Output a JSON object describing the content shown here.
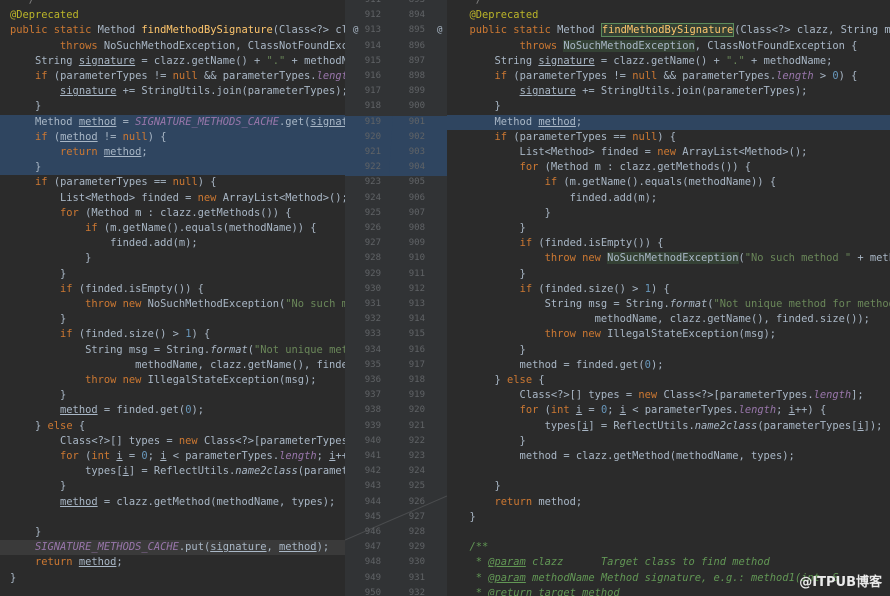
{
  "left_lines": [
    [
      {
        "t": "  */",
        "c": "cmt"
      }
    ],
    [
      {
        "t": "@Deprecated",
        "c": "ann"
      }
    ],
    [
      {
        "t": "public static ",
        "c": "kw"
      },
      {
        "t": "Method "
      },
      {
        "t": "findMethodBySignature",
        "c": "fn"
      },
      {
        "t": "(Class<?> cla"
      }
    ],
    [
      {
        "t": "        "
      },
      {
        "t": "throws ",
        "c": "kw"
      },
      {
        "t": "NoSuchMethodException, ClassNotFoundException"
      }
    ],
    [
      {
        "t": "    String "
      },
      {
        "t": "signature",
        "c": "u"
      },
      {
        "t": " = clazz.getName() + "
      },
      {
        "t": "\".\"",
        "c": "str"
      },
      {
        "t": " + methodName;"
      }
    ],
    [
      {
        "t": "    "
      },
      {
        "t": "if ",
        "c": "kw"
      },
      {
        "t": "(parameterTypes != "
      },
      {
        "t": "null ",
        "c": "kw"
      },
      {
        "t": "&& parameterTypes."
      },
      {
        "t": "length",
        "c": "fld"
      },
      {
        "t": " > "
      },
      {
        "t": "0",
        "c": "num"
      },
      {
        "t": ")"
      }
    ],
    [
      {
        "t": "        "
      },
      {
        "t": "signature",
        "c": "u"
      },
      {
        "t": " += StringUtils.join(parameterTypes);"
      }
    ],
    [
      {
        "t": "    }"
      }
    ],
    [
      {
        "t": "    Method "
      },
      {
        "t": "method",
        "c": "u"
      },
      {
        "t": " = "
      },
      {
        "t": "SIGNATURE_METHODS_CACHE",
        "c": "fld"
      },
      {
        "t": ".get("
      },
      {
        "t": "signature",
        "c": "u"
      },
      {
        "t": ");"
      }
    ],
    [
      {
        "t": "    "
      },
      {
        "t": "if ",
        "c": "kw"
      },
      {
        "t": "("
      },
      {
        "t": "method",
        "c": "u"
      },
      {
        "t": " != "
      },
      {
        "t": "null",
        "c": "kw"
      },
      {
        "t": ") {"
      }
    ],
    [
      {
        "t": "        "
      },
      {
        "t": "return ",
        "c": "kw"
      },
      {
        "t": "method",
        "c": "u"
      },
      {
        "t": ";"
      }
    ],
    [
      {
        "t": "    }"
      }
    ],
    [
      {
        "t": "    "
      },
      {
        "t": "if ",
        "c": "kw"
      },
      {
        "t": "(parameterTypes == "
      },
      {
        "t": "null",
        "c": "kw"
      },
      {
        "t": ") {"
      }
    ],
    [
      {
        "t": "        List<Method> finded = "
      },
      {
        "t": "new ",
        "c": "kw"
      },
      {
        "t": "ArrayList<Method>();"
      }
    ],
    [
      {
        "t": "        "
      },
      {
        "t": "for ",
        "c": "kw"
      },
      {
        "t": "(Method m : clazz.getMethods()) {"
      }
    ],
    [
      {
        "t": "            "
      },
      {
        "t": "if ",
        "c": "kw"
      },
      {
        "t": "(m.getName().equals(methodName)) {"
      }
    ],
    [
      {
        "t": "                finded.add(m);"
      }
    ],
    [
      {
        "t": "            }"
      }
    ],
    [
      {
        "t": "        }"
      }
    ],
    [
      {
        "t": "        "
      },
      {
        "t": "if ",
        "c": "kw"
      },
      {
        "t": "(finded.isEmpty()) {"
      }
    ],
    [
      {
        "t": "            "
      },
      {
        "t": "throw new ",
        "c": "kw"
      },
      {
        "t": "NoSuchMethodException("
      },
      {
        "t": "\"No such method \"",
        "c": "str"
      }
    ],
    [
      {
        "t": "        }"
      }
    ],
    [
      {
        "t": "        "
      },
      {
        "t": "if ",
        "c": "kw"
      },
      {
        "t": "(finded.size() > "
      },
      {
        "t": "1",
        "c": "num"
      },
      {
        "t": ") {"
      }
    ],
    [
      {
        "t": "            String msg = String."
      },
      {
        "t": "format",
        "c": "st"
      },
      {
        "t": "("
      },
      {
        "t": "\"Not unique method for",
        "c": "str"
      }
    ],
    [
      {
        "t": "                    methodName, clazz.getName(), finded.size("
      }
    ],
    [
      {
        "t": "            "
      },
      {
        "t": "throw new ",
        "c": "kw"
      },
      {
        "t": "IllegalStateException(msg);"
      }
    ],
    [
      {
        "t": "        }"
      }
    ],
    [
      {
        "t": "        "
      },
      {
        "t": "method",
        "c": "u"
      },
      {
        "t": " = finded.get("
      },
      {
        "t": "0",
        "c": "num"
      },
      {
        "t": ");"
      }
    ],
    [
      {
        "t": "    } "
      },
      {
        "t": "else ",
        "c": "kw"
      },
      {
        "t": "{"
      }
    ],
    [
      {
        "t": "        Class<?>[] types = "
      },
      {
        "t": "new ",
        "c": "kw"
      },
      {
        "t": "Class<?>[parameterTypes."
      },
      {
        "t": "length",
        "c": "fld"
      }
    ],
    [
      {
        "t": "        "
      },
      {
        "t": "for ",
        "c": "kw"
      },
      {
        "t": "("
      },
      {
        "t": "int ",
        "c": "kw"
      },
      {
        "t": "i",
        "c": "u"
      },
      {
        "t": " = "
      },
      {
        "t": "0",
        "c": "num"
      },
      {
        "t": "; "
      },
      {
        "t": "i",
        "c": "u"
      },
      {
        "t": " < parameterTypes."
      },
      {
        "t": "length",
        "c": "fld"
      },
      {
        "t": "; "
      },
      {
        "t": "i",
        "c": "u"
      },
      {
        "t": "++) {"
      }
    ],
    [
      {
        "t": "            types["
      },
      {
        "t": "i",
        "c": "u"
      },
      {
        "t": "] = ReflectUtils."
      },
      {
        "t": "name2class",
        "c": "st"
      },
      {
        "t": "(parameterTypes"
      }
    ],
    [
      {
        "t": "        }"
      }
    ],
    [
      {
        "t": "        "
      },
      {
        "t": "method",
        "c": "u"
      },
      {
        "t": " = clazz.getMethod(methodName, types);"
      }
    ],
    [
      {
        "t": ""
      }
    ],
    [
      {
        "t": "    }"
      }
    ],
    [
      {
        "t": "    "
      },
      {
        "t": "SIGNATURE_METHODS_CACHE",
        "c": "fld"
      },
      {
        "t": ".put("
      },
      {
        "t": "signature",
        "c": "u"
      },
      {
        "t": ", "
      },
      {
        "t": "method",
        "c": "u"
      },
      {
        "t": ");"
      }
    ],
    [
      {
        "t": "    "
      },
      {
        "t": "return ",
        "c": "kw"
      },
      {
        "t": "method",
        "c": "u"
      },
      {
        "t": ";"
      }
    ],
    [
      {
        "t": "}"
      }
    ]
  ],
  "right_lines": [
    [
      {
        "t": "  */",
        "c": "cmt"
      }
    ],
    [
      {
        "t": "  @Deprecated",
        "c": "ann"
      }
    ],
    [
      {
        "t": "  public static ",
        "c": "kw"
      },
      {
        "t": "Method "
      },
      {
        "t": "findMethodBySignature",
        "c": "box"
      },
      {
        "t": "(Class<?> clazz, String meth"
      }
    ],
    [
      {
        "t": "          "
      },
      {
        "t": "throws ",
        "c": "kw"
      },
      {
        "t": "NoSuchMethodException",
        "c": "hb"
      },
      {
        "t": ", ClassNotFoundException {"
      }
    ],
    [
      {
        "t": "      String "
      },
      {
        "t": "signature",
        "c": "u"
      },
      {
        "t": " = clazz.getName() + "
      },
      {
        "t": "\".\"",
        "c": "str"
      },
      {
        "t": " + methodName;"
      }
    ],
    [
      {
        "t": "      "
      },
      {
        "t": "if ",
        "c": "kw"
      },
      {
        "t": "(parameterTypes != "
      },
      {
        "t": "null ",
        "c": "kw"
      },
      {
        "t": "&& parameterTypes."
      },
      {
        "t": "length",
        "c": "fld"
      },
      {
        "t": " > "
      },
      {
        "t": "0",
        "c": "num"
      },
      {
        "t": ") {"
      }
    ],
    [
      {
        "t": "          "
      },
      {
        "t": "signature",
        "c": "u"
      },
      {
        "t": " += StringUtils.join(parameterTypes);"
      }
    ],
    [
      {
        "t": "      }"
      }
    ],
    [
      {
        "t": "      Method "
      },
      {
        "t": "method",
        "c": "u"
      },
      {
        "t": ";"
      }
    ],
    [
      {
        "t": "      "
      },
      {
        "t": "if ",
        "c": "kw"
      },
      {
        "t": "(parameterTypes == "
      },
      {
        "t": "null",
        "c": "kw"
      },
      {
        "t": ") {"
      }
    ],
    [
      {
        "t": "          List<Method> finded = "
      },
      {
        "t": "new ",
        "c": "kw"
      },
      {
        "t": "ArrayList<Method>();"
      }
    ],
    [
      {
        "t": "          "
      },
      {
        "t": "for ",
        "c": "kw"
      },
      {
        "t": "(Method m : clazz.getMethods()) {"
      }
    ],
    [
      {
        "t": "              "
      },
      {
        "t": "if ",
        "c": "kw"
      },
      {
        "t": "(m.getName().equals(methodName)) {"
      }
    ],
    [
      {
        "t": "                  finded.add(m);"
      }
    ],
    [
      {
        "t": "              }"
      }
    ],
    [
      {
        "t": "          }"
      }
    ],
    [
      {
        "t": "          "
      },
      {
        "t": "if ",
        "c": "kw"
      },
      {
        "t": "(finded.isEmpty()) {"
      }
    ],
    [
      {
        "t": "              "
      },
      {
        "t": "throw new ",
        "c": "kw"
      },
      {
        "t": "NoSuchMethodException",
        "c": "hb"
      },
      {
        "t": "("
      },
      {
        "t": "\"No such method \"",
        "c": "str"
      },
      {
        "t": " + methodName"
      }
    ],
    [
      {
        "t": "          }"
      }
    ],
    [
      {
        "t": "          "
      },
      {
        "t": "if ",
        "c": "kw"
      },
      {
        "t": "(finded.size() > "
      },
      {
        "t": "1",
        "c": "num"
      },
      {
        "t": ") {"
      }
    ],
    [
      {
        "t": "              String msg = String."
      },
      {
        "t": "format",
        "c": "st"
      },
      {
        "t": "("
      },
      {
        "t": "\"Not unique method for method name(%",
        "c": "str"
      }
    ],
    [
      {
        "t": "                      methodName, clazz.getName(), finded.size());"
      }
    ],
    [
      {
        "t": "              "
      },
      {
        "t": "throw new ",
        "c": "kw"
      },
      {
        "t": "IllegalStateException(msg);"
      }
    ],
    [
      {
        "t": "          }"
      }
    ],
    [
      {
        "t": "          method = finded.get("
      },
      {
        "t": "0",
        "c": "num"
      },
      {
        "t": ");"
      }
    ],
    [
      {
        "t": "      } "
      },
      {
        "t": "else ",
        "c": "kw"
      },
      {
        "t": "{"
      }
    ],
    [
      {
        "t": "          Class<?>[] types = "
      },
      {
        "t": "new ",
        "c": "kw"
      },
      {
        "t": "Class<?>[parameterTypes."
      },
      {
        "t": "length",
        "c": "fld"
      },
      {
        "t": "];"
      }
    ],
    [
      {
        "t": "          "
      },
      {
        "t": "for ",
        "c": "kw"
      },
      {
        "t": "("
      },
      {
        "t": "int ",
        "c": "kw"
      },
      {
        "t": "i",
        "c": "u"
      },
      {
        "t": " = "
      },
      {
        "t": "0",
        "c": "num"
      },
      {
        "t": "; "
      },
      {
        "t": "i",
        "c": "u"
      },
      {
        "t": " < parameterTypes."
      },
      {
        "t": "length",
        "c": "fld"
      },
      {
        "t": "; "
      },
      {
        "t": "i",
        "c": "u"
      },
      {
        "t": "++) {"
      }
    ],
    [
      {
        "t": "              types["
      },
      {
        "t": "i",
        "c": "u"
      },
      {
        "t": "] = ReflectUtils."
      },
      {
        "t": "name2class",
        "c": "st"
      },
      {
        "t": "(parameterTypes["
      },
      {
        "t": "i",
        "c": "u"
      },
      {
        "t": "]);"
      }
    ],
    [
      {
        "t": "          }"
      }
    ],
    [
      {
        "t": "          method = clazz.getMethod(methodName, types);"
      }
    ],
    [
      {
        "t": ""
      }
    ],
    [
      {
        "t": "      }"
      }
    ],
    [
      {
        "t": "      "
      },
      {
        "t": "return ",
        "c": "kw"
      },
      {
        "t": "method;"
      }
    ],
    [
      {
        "t": "  }"
      }
    ],
    [
      {
        "t": ""
      }
    ],
    [
      {
        "t": "  /**",
        "c": "cm"
      }
    ],
    [
      {
        "t": "   * ",
        "c": "cm"
      },
      {
        "t": "@param",
        "c": "cmu"
      },
      {
        "t": " clazz      Target class to find method",
        "c": "cm"
      }
    ],
    [
      {
        "t": "   * ",
        "c": "cm"
      },
      {
        "t": "@param",
        "c": "cmu"
      },
      {
        "t": " methodName Method signature, e.g.: method1(int, S",
        "c": "cm"
      }
    ],
    [
      {
        "t": "   * ",
        "c": "cm"
      },
      {
        "t": "@return",
        "c": "cmu"
      },
      {
        "t": " target method",
        "c": "cm"
      }
    ]
  ],
  "left_line_numbers": [
    "911",
    "912",
    "913",
    "914",
    "915",
    "916",
    "917",
    "918",
    "919",
    "920",
    "921",
    "922",
    "923",
    "924",
    "925",
    "926",
    "927",
    "928",
    "929",
    "930",
    "931",
    "932",
    "933",
    "934",
    "935",
    "936",
    "937",
    "938",
    "939",
    "940",
    "941",
    "942",
    "943",
    "944",
    "945",
    "946",
    "947",
    "948",
    "949",
    "950"
  ],
  "right_line_numbers": [
    "893",
    "894",
    "895",
    "896",
    "897",
    "898",
    "899",
    "900",
    "901",
    "902",
    "903",
    "904",
    "905",
    "906",
    "907",
    "908",
    "909",
    "910",
    "911",
    "912",
    "913",
    "914",
    "915",
    "916",
    "917",
    "918",
    "919",
    "920",
    "921",
    "922",
    "923",
    "924",
    "925",
    "926",
    "927",
    "928",
    "929",
    "930",
    "931",
    "932"
  ],
  "gutter_marker": "@",
  "watermark": "@ITPUB博客"
}
